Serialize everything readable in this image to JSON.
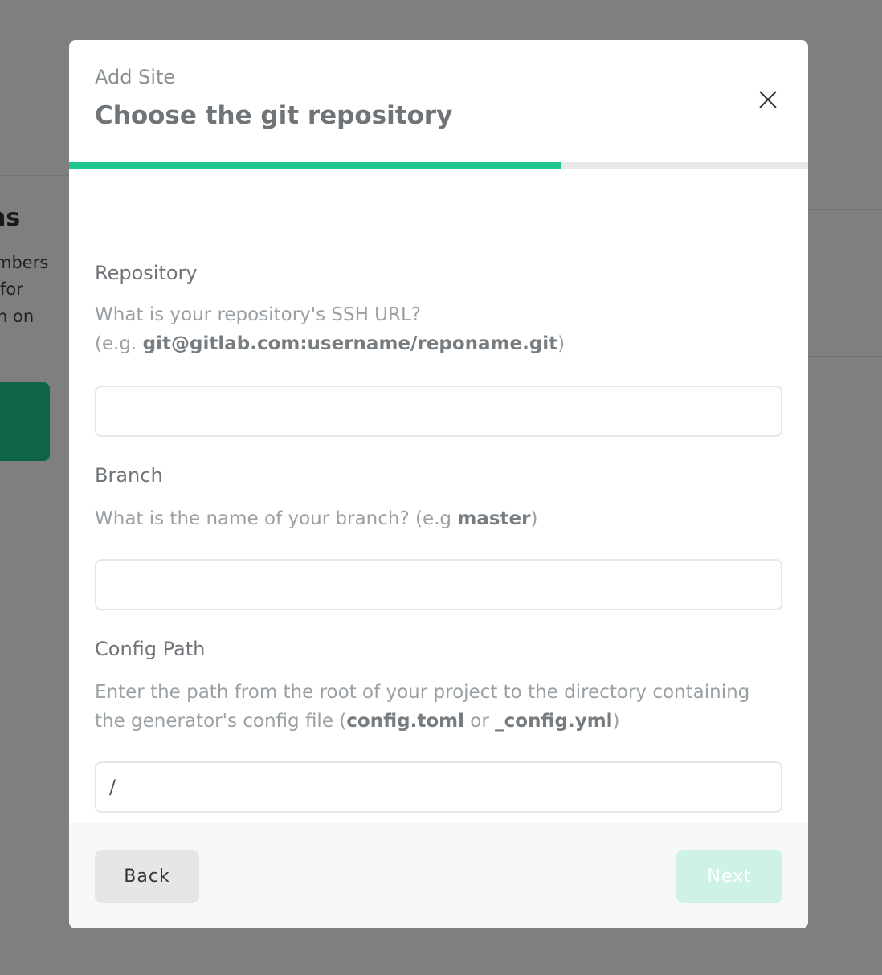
{
  "background": {
    "heading_fragment": "ns",
    "text_lines": [
      "mbers",
      "for",
      "n on"
    ]
  },
  "modal": {
    "subtitle": "Add Site",
    "title": "Choose the git repository",
    "progress_fraction": 0.666,
    "fields": {
      "repository": {
        "label": "Repository",
        "help_line1": "What is your repository's SSH URL?",
        "help_prefix": "(e.g. ",
        "help_example": "git@gitlab.com:username/reponame.git",
        "help_suffix": ")",
        "value": ""
      },
      "branch": {
        "label": "Branch",
        "help_prefix": "What is the name of your branch? (e.g ",
        "help_example": "master",
        "help_suffix": ")",
        "value": ""
      },
      "config_path": {
        "label": "Config Path",
        "help_text": "Enter the path from the root of your project to the directory containing the generator's config file (",
        "help_example1": "config.toml",
        "help_or": " or ",
        "help_example2": "_config.yml",
        "help_suffix": ")",
        "value": "/"
      }
    },
    "footer": {
      "back_label": "Back",
      "next_label": "Next"
    }
  },
  "colors": {
    "accent": "#1ec690",
    "next_disabled": "#cef3e6"
  }
}
